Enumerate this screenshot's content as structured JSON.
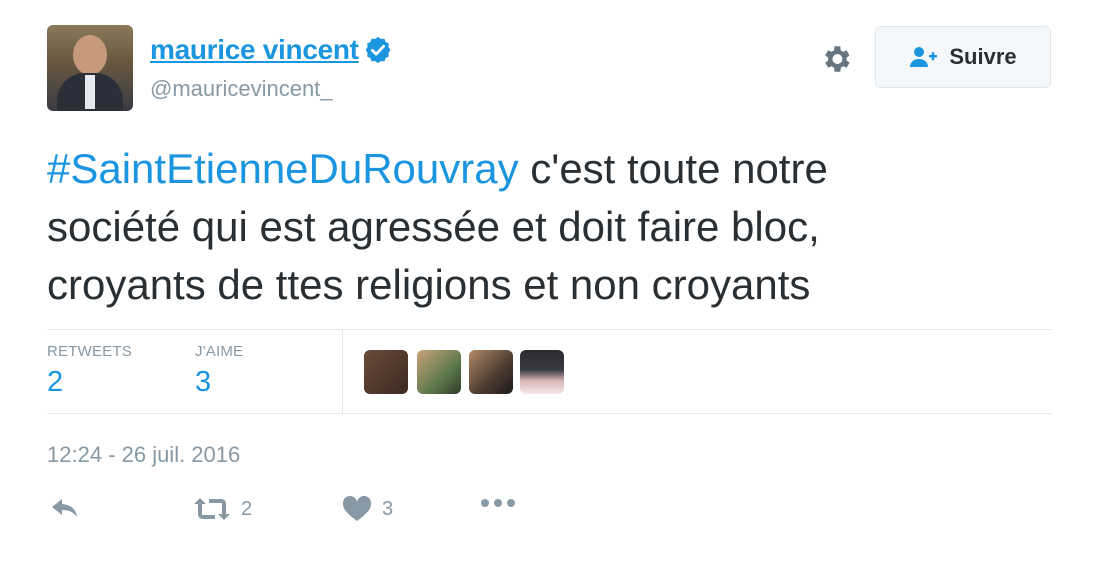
{
  "author": {
    "name": "maurice vincent",
    "handle": "@mauricevincent_"
  },
  "follow_button": {
    "label": "Suivre"
  },
  "tweet": {
    "hashtag": "#SaintEtienneDuRouvray",
    "text_line1": " c'est toute notre",
    "text_line2": "société qui est agressée et doit faire bloc,",
    "text_line3": "croyants de ttes religions et non croyants"
  },
  "stats": {
    "retweets_label": "RETWEETS",
    "retweets_value": "2",
    "likes_label": "J'AIME",
    "likes_value": "3"
  },
  "timestamp": "12:24 - 26 juil. 2016",
  "actions": {
    "retweet_count": "2",
    "like_count": "3"
  },
  "colors": {
    "link_blue": "#1b95e0",
    "text": "#292f33",
    "muted": "#8899a6",
    "border": "#e1e8ed"
  }
}
